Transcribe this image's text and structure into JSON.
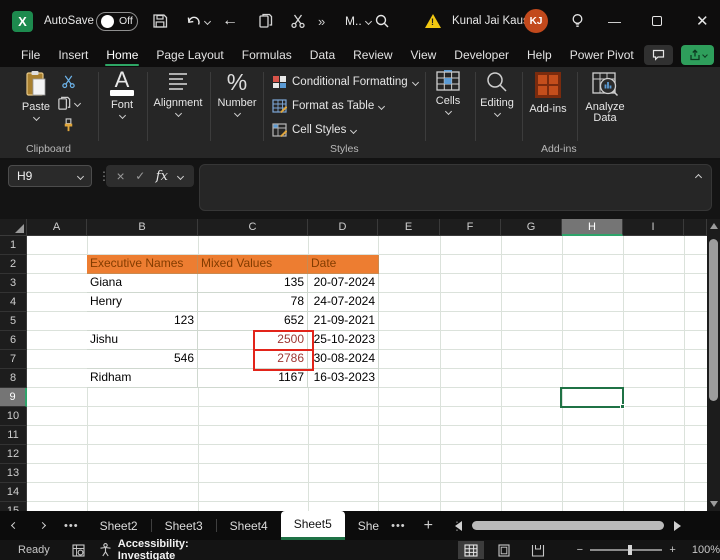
{
  "colors": {
    "accent_green": "#21A366",
    "table_header_fill": "#ED7D31",
    "table_header_text": "#833C00",
    "alert_red": "#E2241A",
    "flagged_value_red": "#9C3632"
  },
  "title_bar": {
    "autosave_label": "AutoSave",
    "autosave_state": "Off",
    "qat_more": "»",
    "qat_custom": "M..",
    "user_name": "Kunal Jai Kaushik",
    "user_initials": "KJ"
  },
  "ribbon_tabs": [
    "File",
    "Insert",
    "Home",
    "Page Layout",
    "Formulas",
    "Data",
    "Review",
    "View",
    "Developer",
    "Help",
    "Power Pivot"
  ],
  "active_tab": "Home",
  "ribbon": {
    "paste": "Paste",
    "clipboard_group": "Clipboard",
    "font": "Font",
    "alignment": "Alignment",
    "number": "Number",
    "styles_items": [
      "Conditional Formatting",
      "Format as Table",
      "Cell Styles"
    ],
    "styles_group": "Styles",
    "cells": "Cells",
    "editing": "Editing",
    "addins": "Add-ins",
    "analyze_line1": "Analyze",
    "analyze_line2": "Data",
    "addins_group": "Add-ins"
  },
  "formula_bar": {
    "name_box": "H9",
    "fx_label": "fx",
    "content": ""
  },
  "grid": {
    "columns": [
      "A",
      "B",
      "C",
      "D",
      "E",
      "F",
      "G",
      "H",
      "I"
    ],
    "rows": [
      "1",
      "2",
      "3",
      "4",
      "5",
      "6",
      "7",
      "8",
      "9",
      "10",
      "11",
      "12",
      "13",
      "14",
      "15"
    ],
    "selected_cell": "H9",
    "table": {
      "headers": [
        "Executive Names",
        "Mixed Values",
        "Date"
      ],
      "rows": [
        {
          "name": "Giana",
          "value": "135",
          "date": "20-07-2024"
        },
        {
          "name": "Henry",
          "value": "78",
          "date": "24-07-2024"
        },
        {
          "name": "123",
          "value": "652",
          "date": "21-09-2021"
        },
        {
          "name": "Jishu",
          "value": "2500",
          "date": "25-10-2023"
        },
        {
          "name": "546",
          "value": "2786",
          "date": "30-08-2024"
        },
        {
          "name": "Ridham",
          "value": "1167",
          "date": "16-03-2023"
        }
      ],
      "red_boxed_cells": [
        "C6",
        "C7"
      ]
    }
  },
  "sheet_bar": {
    "tabs": [
      "Sheet2",
      "Sheet3",
      "Sheet4",
      "Sheet5",
      "She"
    ],
    "active": "Sheet5",
    "dots": "•••",
    "add": "+",
    "menu": "⋮"
  },
  "status_bar": {
    "ready": "Ready",
    "accessibility": "Accessibility: Investigate",
    "zoom": "100%",
    "minus": "−",
    "plus": "+"
  }
}
